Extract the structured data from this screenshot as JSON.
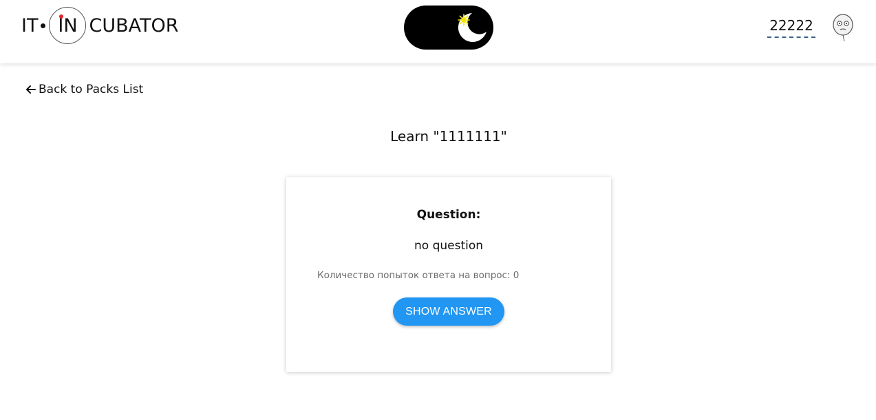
{
  "header": {
    "logo": {
      "part1": "IT",
      "part2": "IN",
      "part3": "CUBATOR"
    },
    "theme_toggle": {
      "state": "dark",
      "icons": [
        "moon-icon",
        "sun-icon"
      ]
    },
    "user_name": "22222",
    "avatar_icon": "avatar-face-icon"
  },
  "nav": {
    "back_label": "Back to Packs List",
    "back_icon": "arrow-left-icon"
  },
  "page": {
    "title": "Learn \"1111111\""
  },
  "card": {
    "label": "Question:",
    "question": "no question",
    "attempts": "Количество попыток ответа на вопрос: 0",
    "show_answer_label": "SHOW ANSWER"
  },
  "colors": {
    "accent": "#2196f3",
    "toggle_bg": "#000000",
    "sun": "#f5e400",
    "username_underline": "#3b5f87"
  }
}
